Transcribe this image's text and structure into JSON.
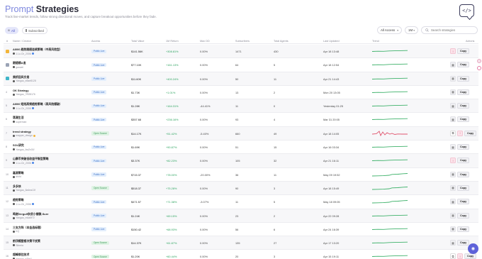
{
  "header": {
    "title_part1": "Prompt",
    "title_part2": "Strategies",
    "subtitle": "Track live-market trends, follow strong directional moves, and capture breakout opportunities before they fade.",
    "logo_icon": "code-bubble-icon"
  },
  "filters": {
    "all_label": "All",
    "subscribed_label": "Subscribed",
    "access_select": "All Access",
    "period_select": "1M",
    "search_placeholder": "Search strategies"
  },
  "columns": [
    "#",
    "Name / Creator",
    "Access",
    "Total Value",
    "1M Return",
    "Max DD",
    "Subscribers",
    "Total Agents",
    "Last Updated",
    "Trend",
    "Actions"
  ],
  "rows": [
    {
      "rank": "1",
      "rank_color": "#f2b53a",
      "name": "AI000 趋势跟随连续策略（中高风险型）",
      "author": "1.Lu.Ch_2006",
      "verified": "#4a86e8",
      "access": "Public Live",
      "access_type": "pub",
      "total_value": "$141.56K",
      "return": "+308.81%",
      "return_neg": false,
      "max_dd": "0.00%",
      "subscribers": "1471",
      "agents": "430",
      "updated": "Apr 18 13:48",
      "trend_color": "#3fb26b",
      "trend_shape": "flat",
      "actions": "pink-copy",
      "copy_label": "Copy"
    },
    {
      "rank": "2",
      "rank_color": "#9aa3b5",
      "name": "跟随横A追",
      "author": "gaowei",
      "verified": "",
      "access": "Public Live",
      "access_type": "pub",
      "total_value": "$77.10K",
      "return": "+161.13%",
      "return_neg": false,
      "max_dd": "0.00%",
      "subscribers": "64",
      "agents": "5",
      "updated": "Apr 18 12:54",
      "trend_color": "#3fb26b",
      "trend_shape": "flat",
      "actions": "copy",
      "copy_label": "Copy"
    },
    {
      "rank": "3",
      "rank_color": "#3fb6c9",
      "name": "美桥回风交易",
      "author": "Yangao_e8ae8128",
      "verified": "",
      "access": "Public Live",
      "access_type": "pub",
      "total_value": "$11.60K",
      "return": "+400.24%",
      "return_neg": false,
      "max_dd": "0.00%",
      "subscribers": "50",
      "agents": "11",
      "updated": "Apr 21 14:43",
      "trend_color": "#3fb26b",
      "trend_shape": "flat",
      "actions": "copy",
      "copy_label": "Copy"
    },
    {
      "rank": "4",
      "rank_color": "",
      "name": "OK Strategy",
      "author": "Yangao_7f928176",
      "verified": "",
      "access": "Public Live",
      "access_type": "pub",
      "total_value": "$1.73K",
      "return": "+1.01%",
      "return_neg": false,
      "max_dd": "0.00%",
      "subscribers": "13",
      "agents": "2",
      "updated": "Mon 20 13:05",
      "trend_color": "#3fb26b",
      "trend_shape": "flat",
      "actions": "copy",
      "copy_label": "Copy"
    },
    {
      "rank": "5",
      "rank_color": "",
      "name": "AI000 短线高频趋势策略（高风险爆破）",
      "author": "1.Lu.Ch_2006",
      "verified": "#4a86e8",
      "access": "Public Live",
      "access_type": "pub",
      "total_value": "$1.28K",
      "return": "+164.31%",
      "return_neg": false,
      "max_dd": "-44.41%",
      "subscribers": "11",
      "agents": "0",
      "updated": "Yesterday 01:25",
      "trend_color": "#3fb26b",
      "trend_shape": "flat",
      "actions": "copy",
      "copy_label": "Copy"
    },
    {
      "rank": "6",
      "rank_color": "",
      "name": "落潮生活",
      "author": "superman",
      "verified": "",
      "access": "Public Live",
      "access_type": "pub",
      "total_value": "$357.68",
      "return": "+236.16%",
      "return_neg": false,
      "max_dd": "0.00%",
      "subscribers": "93",
      "agents": "4",
      "updated": "Mar 31 20:05",
      "trend_color": "#3fb26b",
      "trend_shape": "flat",
      "actions": "copy",
      "copy_label": "Copy"
    },
    {
      "rank": "7",
      "rank_color": "",
      "name": "trend strategy",
      "author": "mapper_design",
      "verified": "#f2b53a",
      "access": "Open Source",
      "access_type": "open",
      "total_value": "$14.17K",
      "return": "+51.42%",
      "return_neg": false,
      "max_dd": "-5.40%",
      "subscribers": "660",
      "agents": "49",
      "updated": "Apr 18 14:05",
      "trend_color": "#e0556e",
      "trend_shape": "volatile",
      "actions": "two-pink-copy",
      "copy_label": "Copy"
    },
    {
      "rank": "8",
      "rank_color": "",
      "name": "SOL研究",
      "author": "Yangao_fxa2x01f",
      "verified": "",
      "access": "Public Live",
      "access_type": "pub",
      "total_value": "$1.69K",
      "return": "+90.87%",
      "return_neg": false,
      "max_dd": "0.00%",
      "subscribers": "51",
      "agents": "15",
      "updated": "Apr 16 03:34",
      "trend_color": "#3fb26b",
      "trend_shape": "flat",
      "actions": "copy",
      "copy_label": "Copy"
    },
    {
      "rank": "9",
      "rank_color": "",
      "name": "山寨币突破低收益平衡型策略",
      "author": "1.Lu.Ch_2006",
      "verified": "#4a86e8",
      "access": "Public Live",
      "access_type": "pub",
      "total_value": "$3.37K",
      "return": "+82.23%",
      "return_neg": false,
      "max_dd": "0.00%",
      "subscribers": "105",
      "agents": "32",
      "updated": "Apr 21 16:11",
      "trend_color": "#3fb26b",
      "trend_shape": "flat",
      "actions": "pink-copy",
      "copy_label": "Copy"
    },
    {
      "rank": "10",
      "rank_color": "",
      "name": "嘉源策略",
      "author": "dhiht",
      "verified": "",
      "access": "Public Live",
      "access_type": "pub",
      "total_value": "$715.37",
      "return": "+78.00%",
      "return_neg": false,
      "max_dd": "-20.00%",
      "subscribers": "36",
      "agents": "11",
      "updated": "May 09 19:52",
      "trend_color": "#3fb26b",
      "trend_shape": "rise",
      "actions": "copy",
      "copy_label": "Copy"
    },
    {
      "rank": "11",
      "rank_color": "",
      "name": "多多快",
      "author": "Yangao_8a4ea13f",
      "verified": "",
      "access": "Open Source",
      "access_type": "open",
      "total_value": "$518.37",
      "return": "+75.28%",
      "return_neg": false,
      "max_dd": "0.00%",
      "subscribers": "90",
      "agents": "3",
      "updated": "Apr 18 15:49",
      "trend_color": "#3fb26b",
      "trend_shape": "rise",
      "actions": "copy",
      "copy_label": "Copy"
    },
    {
      "rank": "12",
      "rank_color": "",
      "name": "趋势策略",
      "author": "1.Lu.Ch_2006",
      "verified": "#4a86e8",
      "access": "Public Live",
      "access_type": "pub",
      "total_value": "$471.57",
      "return": "+71.38%",
      "return_neg": false,
      "max_dd": "-3.07%",
      "subscribers": "11",
      "agents": "5",
      "updated": "May 18 09:05",
      "trend_color": "#3fb26b",
      "trend_shape": "rise",
      "actions": "copy",
      "copy_label": "Copy"
    },
    {
      "rank": "13",
      "rank_color": "",
      "name": "鸣谢Vergulf杂货小铺微-Sure",
      "author": "Yangao_m4a5f72",
      "verified": "",
      "access": "Public Live",
      "access_type": "pub",
      "total_value": "$1.24K",
      "return": "+69.15%",
      "return_neg": false,
      "max_dd": "0.00%",
      "subscribers": "23",
      "agents": "2",
      "updated": "Apr 22 09:28",
      "trend_color": "#3fb26b",
      "trend_shape": "flat",
      "actions": "copy",
      "copy_label": "Copy"
    },
    {
      "rank": "14",
      "rank_color": "",
      "name": "三支方阵（本金选标题）",
      "author": "KQ",
      "verified": "",
      "access": "Public Live",
      "access_type": "pub",
      "total_value": "$150.42",
      "return": "+68.93%",
      "return_neg": false,
      "max_dd": "0.00%",
      "subscribers": "56",
      "agents": "6",
      "updated": "Apr 24 16:39",
      "trend_color": "#3fb26b",
      "trend_shape": "flat",
      "actions": "copy",
      "copy_label": "Copy"
    },
    {
      "rank": "15",
      "rank_color": "",
      "name": "前顶帽壁楼次策干扰策",
      "author": "Siberia",
      "verified": "",
      "access": "Open Source",
      "access_type": "open",
      "total_value": "$14.37K",
      "return": "+61.87%",
      "return_neg": false,
      "max_dd": "0.00%",
      "subscribers": "135",
      "agents": "27",
      "updated": "Apr 17 13:20",
      "trend_color": "#3fb26b",
      "trend_shape": "flat",
      "actions": "copy",
      "copy_label": "Copy"
    },
    {
      "rank": "16",
      "rank_color": "",
      "name": "超峰锁住技术",
      "author": "Yangao_e7be1",
      "verified": "",
      "access": "Open Source",
      "access_type": "open",
      "total_value": "$1.20K",
      "return": "+60.44%",
      "return_neg": false,
      "max_dd": "0.00%",
      "subscribers": "20",
      "agents": "3",
      "updated": "Apr 15 19:11",
      "trend_color": "#3fb26b",
      "trend_shape": "flat",
      "actions": "two-pink-copy",
      "copy_label": "Copy"
    }
  ]
}
